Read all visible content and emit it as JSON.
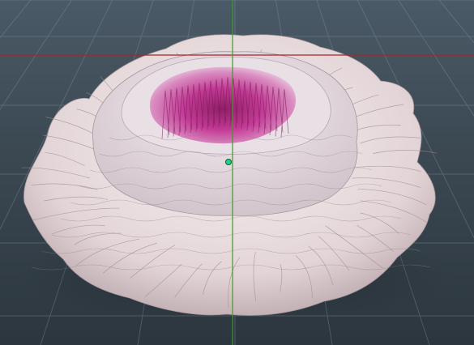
{
  "viewport": {
    "background_top": "#4a5a66",
    "background_bottom": "#2c363e",
    "grid_color": "#8a99a5",
    "axis_x_color": "#a3262a",
    "axis_y_color": "#3f9a2a",
    "pivot_color": "#1fd38a"
  },
  "model": {
    "subject": "peony-flower",
    "petal_color": "#e8dcdc",
    "petal_shadow_color": "#b9a6aa",
    "center_color": "#c23a95"
  }
}
